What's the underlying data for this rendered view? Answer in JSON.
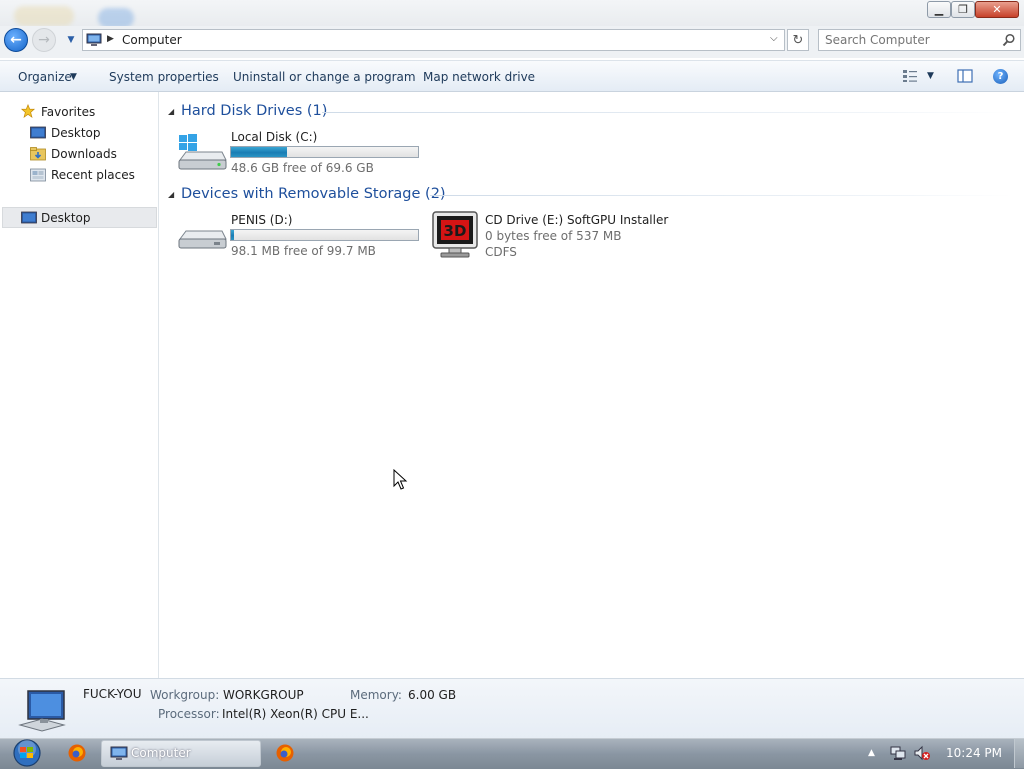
{
  "window": {
    "address": "Computer",
    "search_placeholder": "Search Computer"
  },
  "commands": {
    "organize": "Organize",
    "system_properties": "System properties",
    "uninstall": "Uninstall or change a program",
    "map_drive": "Map network drive"
  },
  "nav": {
    "favorites": "Favorites",
    "items": [
      "Desktop",
      "Downloads",
      "Recent places"
    ],
    "selected": "Desktop"
  },
  "groups": {
    "hard_disks": {
      "title": "Hard Disk Drives (1)",
      "drives": [
        {
          "name": "Local Disk (C:)",
          "free": "48.6 GB free of 69.6 GB",
          "used_fraction": 0.3
        }
      ]
    },
    "removable": {
      "title": "Devices with Removable Storage (2)",
      "drives": [
        {
          "name": "PENIS (D:)",
          "free": "98.1 MB free of 99.7 MB",
          "used_fraction": 0.016
        },
        {
          "name": "CD Drive (E:) SoftGPU Installer",
          "free": "0 bytes free of 537 MB",
          "fs": "CDFS",
          "icon_text": "3D"
        }
      ]
    }
  },
  "details": {
    "computer_name": "FUCK-YOU",
    "workgroup_label": "Workgroup:",
    "workgroup": "WORKGROUP",
    "memory_label": "Memory:",
    "memory": "6.00 GB",
    "processor_label": "Processor:",
    "processor": "Intel(R) Xeon(R) CPU E..."
  },
  "taskbar": {
    "explorer_label": "Computer",
    "clock": "10:24 PM"
  },
  "colors": {
    "accent": "#1e4f9c",
    "capacity_bar": "#1a7db4",
    "cd_icon_red": "#d41414"
  }
}
